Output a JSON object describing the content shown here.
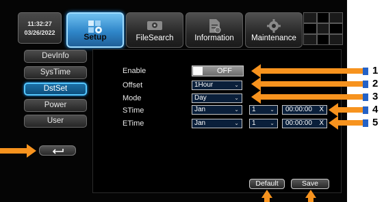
{
  "clock": {
    "time": "11:32:27",
    "date": "03/26/2022"
  },
  "tabs": [
    {
      "label": "Setup",
      "icon": "setup-icon",
      "active": true
    },
    {
      "label": "FileSearch",
      "icon": "hdd-icon",
      "active": false
    },
    {
      "label": "Information",
      "icon": "document-icon",
      "active": false
    },
    {
      "label": "Maintenance",
      "icon": "gear-icon",
      "active": false
    }
  ],
  "sidebar": {
    "items": [
      {
        "label": "DevInfo",
        "active": false
      },
      {
        "label": "SysTime",
        "active": false
      },
      {
        "label": "DstSet",
        "active": true
      },
      {
        "label": "Power",
        "active": false
      },
      {
        "label": "User",
        "active": false
      }
    ]
  },
  "form": {
    "enable": {
      "label": "Enable",
      "value": "OFF"
    },
    "offset": {
      "label": "Offset",
      "value": "1Hour"
    },
    "mode": {
      "label": "Mode",
      "value": "Day"
    },
    "stime": {
      "label": "STime",
      "month": "Jan",
      "day": "1",
      "time": "00:00:00"
    },
    "etime": {
      "label": "ETime",
      "month": "Jan",
      "day": "1",
      "time": "00:00:00"
    }
  },
  "buttons": {
    "default": "Default",
    "save": "Save"
  },
  "callouts": [
    "1",
    "2",
    "3",
    "4",
    "5"
  ],
  "colors": {
    "accent": "#2f86c9",
    "arrow": "#f7931e",
    "callout_blue": "#2462c7"
  }
}
